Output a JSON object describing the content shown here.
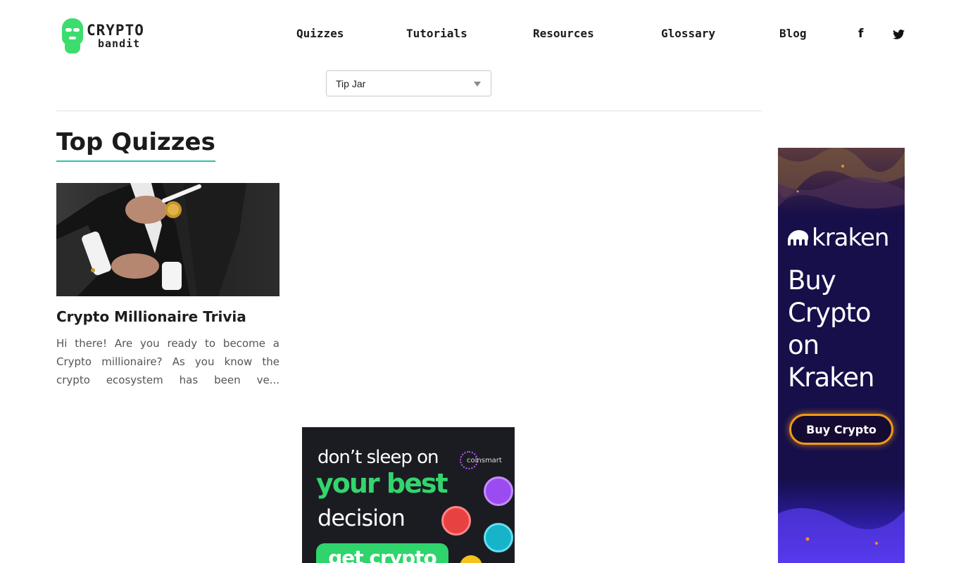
{
  "logo": {
    "line1": "CRYPTO",
    "line2": "bandit",
    "icon": "mask-icon",
    "color": "#3ddc6e"
  },
  "nav": {
    "items": [
      {
        "label": "Quizzes"
      },
      {
        "label": "Tutorials"
      },
      {
        "label": "Resources"
      },
      {
        "label": "Glossary"
      },
      {
        "label": "Blog"
      }
    ],
    "social": [
      {
        "label": "f",
        "icon": "facebook-icon"
      },
      {
        "icon": "twitter-icon"
      }
    ]
  },
  "tip_jar": {
    "selected": "Tip Jar",
    "icon": "chevron-down-icon"
  },
  "main": {
    "section_title": "Top Quizzes",
    "accent_color": "#2bc5a3",
    "quizzes": [
      {
        "title": "Crypto Millionaire Trivia",
        "description": "Hi there! Are you ready to become a Crypto millionaire? As you know the crypto ecosystem has been ve...",
        "image": "businessman-holding-bitcoin"
      }
    ]
  },
  "ads": {
    "kraken": {
      "brand": "kraken",
      "headline_lines": [
        "Buy",
        "Crypto",
        "on",
        "Kraken"
      ],
      "cta": "Buy Crypto",
      "cta_color": "#f29a16",
      "bg_color": "#160f4a"
    },
    "coinsmart": {
      "line1": "don’t sleep on",
      "line2": "your best",
      "line3": "decision",
      "brand": "coinsmart",
      "cta": "get crypto",
      "accent_color": "#33d56d"
    }
  }
}
